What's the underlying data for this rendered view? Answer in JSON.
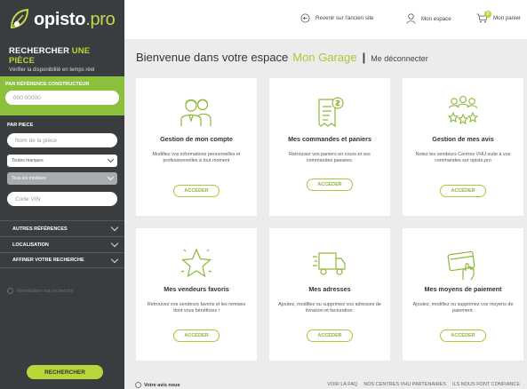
{
  "brand": {
    "name": "opisto",
    "suffix": ".pro"
  },
  "sidebar": {
    "search_title_a": "RECHERCHER",
    "search_title_b": "UNE PIÈCE",
    "search_sub": "Vérifier la disponibilité en temps réel",
    "ref_label": "PAR RÉFÉRENCE CONSTRUCTEUR",
    "ref_placeholder": "000 00000",
    "piece_label": "PAR PIECE",
    "piece_placeholder": "Nom de la pièce",
    "brand_select": "Toutes marques",
    "model_select": "Tous les modèles",
    "vin_placeholder": "Code VIN",
    "accordions": [
      "AUTRES RÉFÉRENCES",
      "LOCALISATION",
      "AFFINER VOTRE RECHERCHE"
    ],
    "reset_label": "Réinitialiser ma recherche",
    "search_button": "RECHERCHER"
  },
  "header": {
    "old_site": "Revenir sur l'ancien site",
    "my_space": "Mon espace",
    "cart": "Mon panier",
    "cart_count": "0"
  },
  "welcome": {
    "text": "Bienvenue dans votre espace",
    "garage": "Mon Garage",
    "separator": "|",
    "logout": "Me déconnecter"
  },
  "cards": [
    {
      "icon": "account-people-icon",
      "title": "Gestion de mon compte",
      "desc": "Modifiez vos informations personnelles et professionnelles à tout moment",
      "button": "ACCÉDER"
    },
    {
      "icon": "orders-invoice-icon",
      "title": "Mes commandes et paniers",
      "desc": "Retrouvez vos paniers en cours et vos commandes passées.",
      "button": "ACCÉDER"
    },
    {
      "icon": "reviews-people-icon",
      "title": "Gestion de mes avis",
      "desc": "Notez les vendeurs Centres VHU suite à vos commandes sur opisto.pro",
      "button": "ACCÉDER"
    },
    {
      "icon": "star-icon",
      "title": "Mes vendeurs favoris",
      "desc": "Retrouvez vos vendeurs favoris et les remises dont vous bénéficiez !",
      "button": "ACCÉDER"
    },
    {
      "icon": "delivery-truck-icon",
      "title": "Mes adresses",
      "desc": "Ajoutez, modifiez ou supprimez vos adresses de livraison et facturation.",
      "button": "ACCÉDER"
    },
    {
      "icon": "payment-card-icon",
      "title": "Mes moyens de paiement",
      "desc": "Ajoutez, modifiez ou supprimez vos moyens de paiement.",
      "button": "ACCÉDER"
    }
  ],
  "footer": {
    "help": "Votre avis nous",
    "links": [
      "VOIR LA FAQ",
      "NOS CENTRES VHU PARTENAIRES",
      "ILS NOUS FONT CONFIANCE"
    ]
  },
  "colors": {
    "accent": "#a8c93a",
    "sidebar": "#393d40",
    "ref_block": "#8cbf3b"
  }
}
